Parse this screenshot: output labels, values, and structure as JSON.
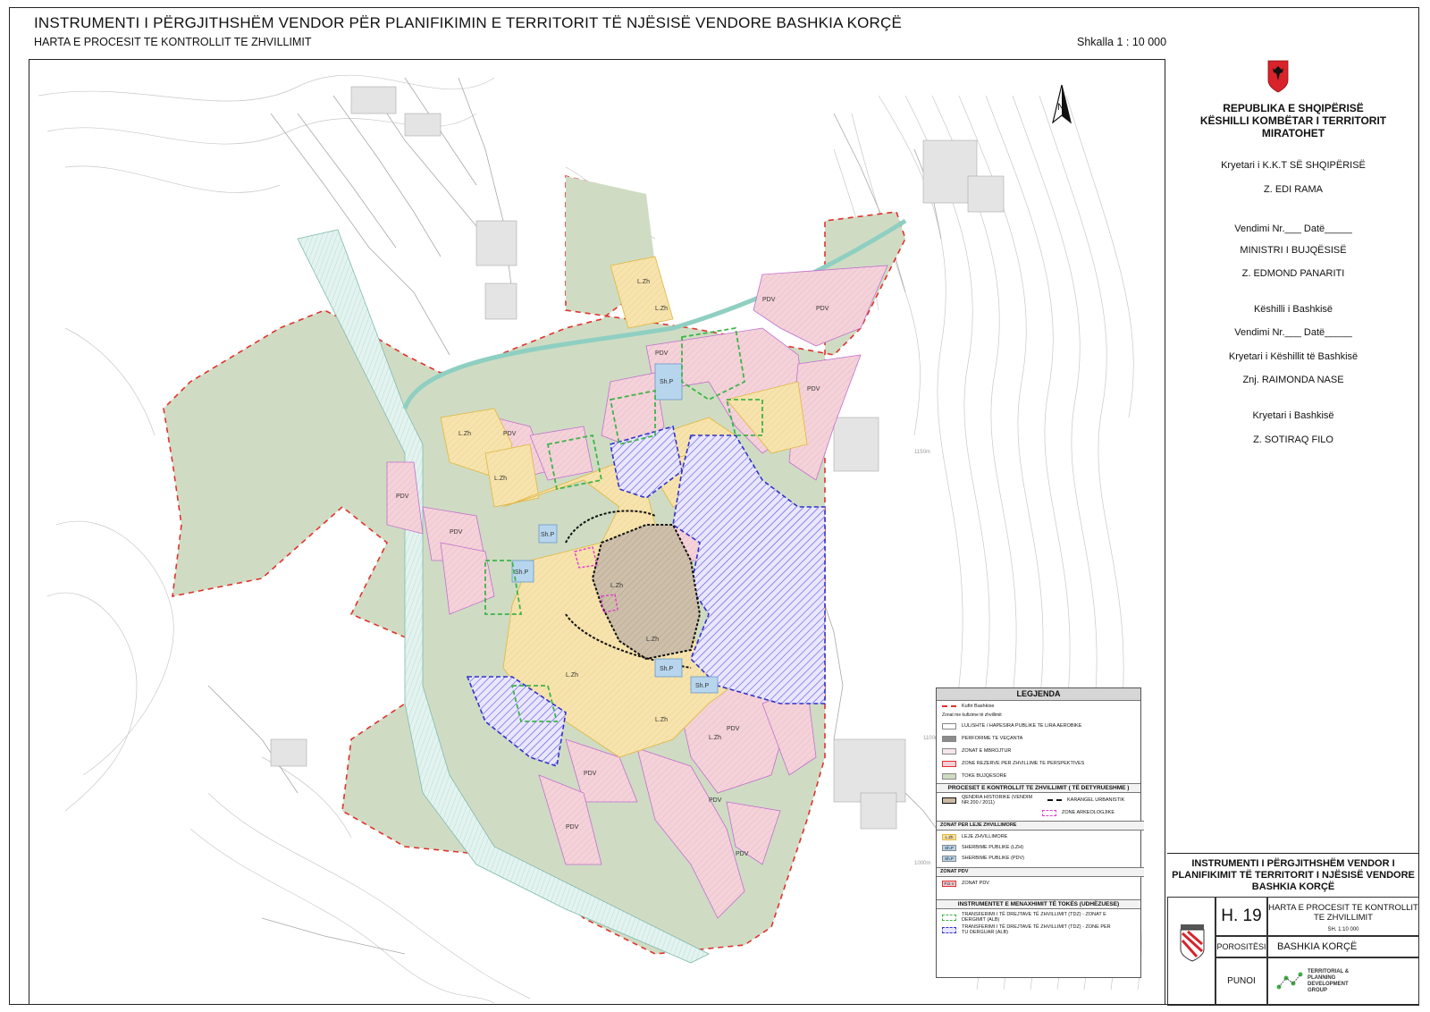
{
  "header": {
    "title": "INSTRUMENTI I PËRGJITHSHËM VENDOR PËR PLANIFIKIMIN E TERRITORIT TË NJËSISË VENDORE BASHKIA KORÇË",
    "subtitle": "HARTA E  PROCESIT TE KONTROLLIT TE ZHVILLIMIT",
    "scale": "Shkalla 1 : 10 000"
  },
  "map": {
    "north_label": "N",
    "zone_labels": [
      "L.Zh",
      "PDV",
      "Sh.P"
    ],
    "contour_labels": [
      "1150m",
      "1100m",
      "1000m"
    ],
    "colors": {
      "agricultural": "#cfdcc3",
      "residential": "#f2cfd6",
      "development": "#f5dfa5",
      "historic": "#c9b9a2",
      "water_channel": "#dcefeb",
      "public_service": "#b7d6ee",
      "urban_boundary": "#e0322c",
      "tdz_green": "#3fb34a",
      "tdz_blue": "#3133c9",
      "historic_border": "#111111",
      "archaeological": "#e23bd2"
    }
  },
  "approval": {
    "country": "REPUBLIKA E SHQIPËRISË",
    "council": "KËSHILLI KOMBËTAR I TERRITORIT",
    "status": "MIRATOHET",
    "kkt_chair_role": "Kryetari i K.K.T SË SHQIPËRISË",
    "kkt_chair_name": "Z. EDI RAMA",
    "decision_1": "Vendimi Nr.___ Datë_____",
    "minister_role": "MINISTRI I BUJQËSISË",
    "minister_name": "Z. EDMOND PANARITI",
    "municipal_council": "Këshilli i Bashkisë",
    "decision_2": "Vendimi Nr.___ Datë_____",
    "council_chair_role": "Kryetari i Këshillit të Bashkisë",
    "council_chair_name": "Znj. RAIMONDA NASE",
    "mayor_role": "Kryetari i Bashkisë",
    "mayor_name": "Z. SOTIRAQ FILO"
  },
  "legend": {
    "title": "LEGJENDA",
    "boundary": "Kufiri Bashkise",
    "zones_heading": "Zonat me kufizime të zhvillimit",
    "items": [
      "LULISHTE / HAPESIRA PUBLIKE TE LIRA AEROBIKE",
      "PERFORIME TE VEÇANTA",
      "ZONAT E MBROJTUR",
      "ZONE REZERVE PER ZHVILLIME TE PERSPEKTIVES",
      "TOKE BUJQESORE"
    ],
    "process_heading": "PROCESET E KONTROLLIT TE ZHVILLIMIT ( TË DETYRUESHME )",
    "historic_center": "QENDRA HISTORIKE (VENDIM NR.200 / 2011)",
    "urban_corridor": "KARANGEL URBANISTIK",
    "archaeological": "ZONE ARKEOLOGJIKE",
    "permit_heading": "ZONAT PER LEJE ZHVILLIMORE",
    "lzh_code": "L.Zh",
    "lzh_label": "LEJE ZHVILLIMORE",
    "shp_code": "Sh.P",
    "shp_label": "SHERBIME PUBLIKE (LZH)",
    "shp2_label": "SHERBIME PUBLIKE (PDV)",
    "pdv_heading": "ZONAT PDV",
    "pdv_code": "P.D.V",
    "pdv_label": "ZONAT PDV",
    "instruments_heading": "INSTRUMENTET E MENAXHIMIT TË TOKËS (UDHËZUESE)",
    "tdz_1": "TRANSFERIMI I TË DREJTAVE TË ZHVILLIMIT (TDZ) - ZONAT E DERGIMIT (ALB)",
    "tdz_2": "TRANSFERIMI I TË DREJTAVE TË ZHVILLIMIT (TDZ) - ZONE PER TU DERGUAR (ALB)"
  },
  "title_block": {
    "title": "INSTRUMENTI I PËRGJITHSHËM VENDOR I PLANIFIKIMIT TË TERRITORIT I NJËSISË VENDORE BASHKIA KORÇË",
    "sheet_no": "H. 19",
    "sheet_title": "HARTA E  PROCESIT TE KONTROLLIT TE ZHVILLIMIT",
    "sheet_scale": "SH. 1:10 000",
    "commissioned_label": "POROSITËSI",
    "commissioned_value": "BASHKIA KORÇË",
    "made_by_label": "PUNOI",
    "firm_name": "TERRITORIAL & PLANNING DEVELOPMENT GROUP"
  }
}
